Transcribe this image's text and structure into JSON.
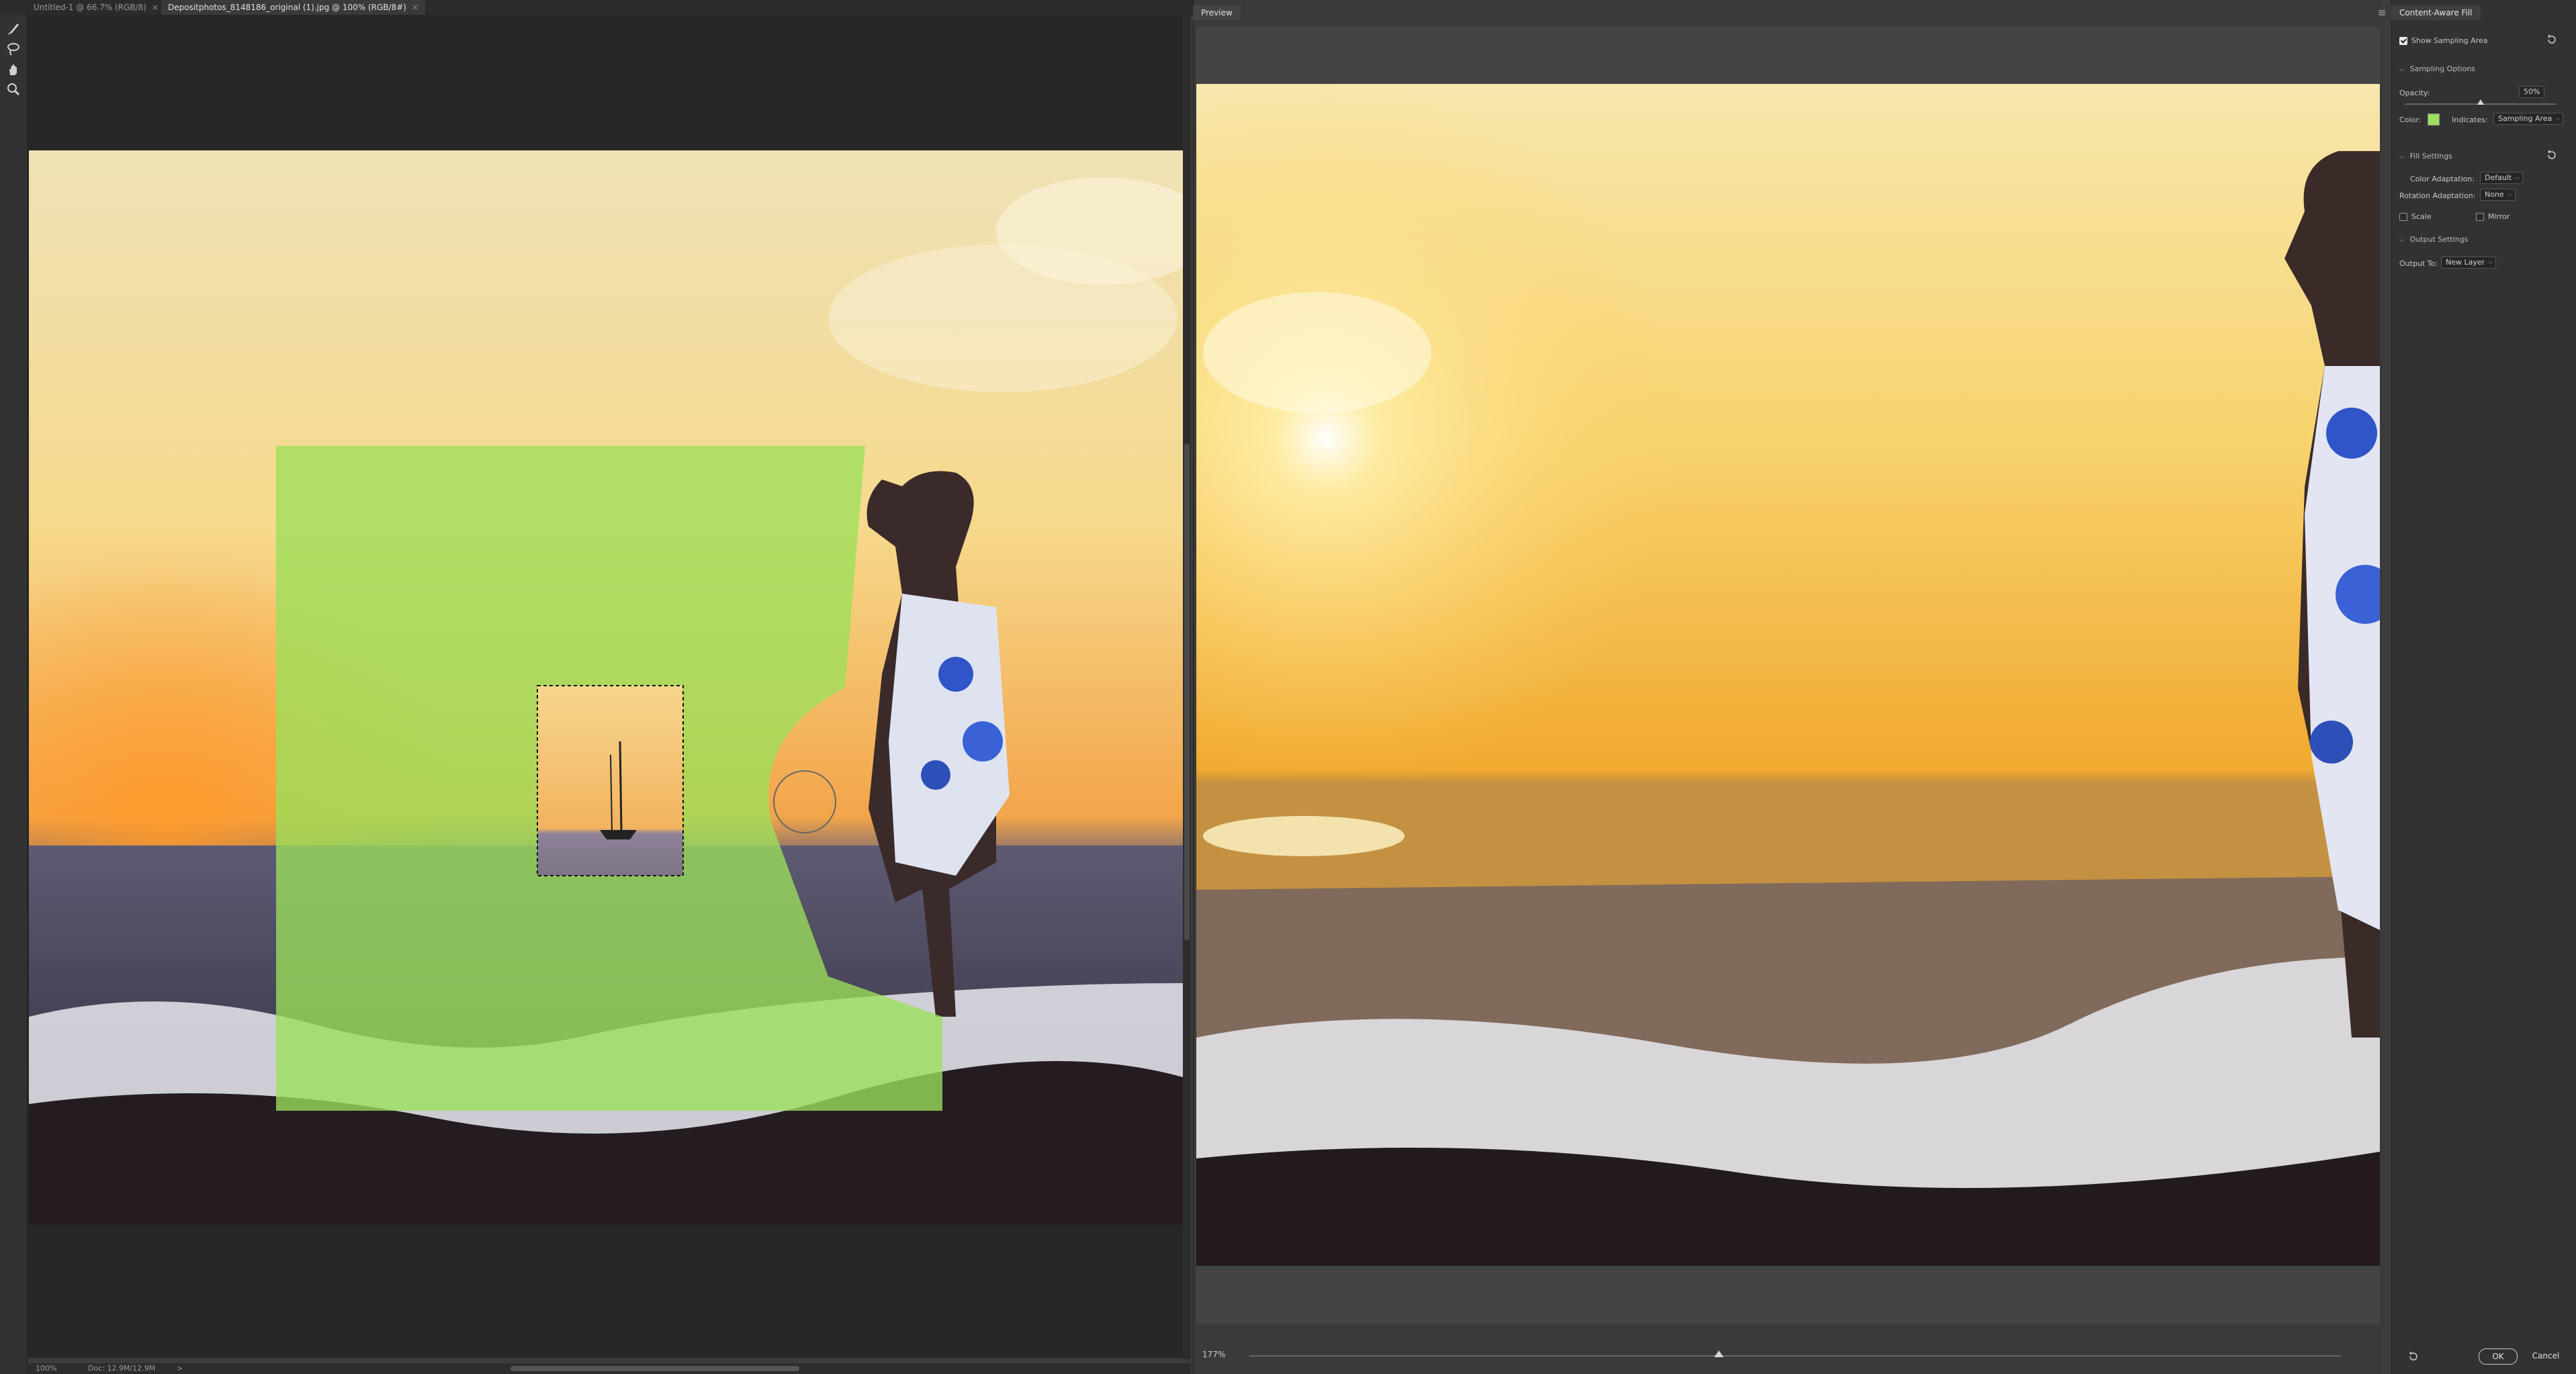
{
  "tabs": [
    {
      "label": "Untitled-1 @ 66.7% (RGB/8)",
      "close": "×"
    },
    {
      "label": "Depositphotos_8148186_original (1).jpg @ 100% (RGB/8#)",
      "close": "×"
    }
  ],
  "tools": [
    "sampling-brush-icon",
    "lasso-icon",
    "hand-icon",
    "zoom-icon"
  ],
  "status": {
    "zoom": "100%",
    "doc": "Doc: 12.9M/12.9M",
    "arrow": ">"
  },
  "preview": {
    "tab": "Preview",
    "zoom": "177%",
    "zoom_slider": 0.43
  },
  "panel": {
    "title": "Content-Aware Fill",
    "show_sampling_area": "Show Sampling Area",
    "sampling_options": "Sampling Options",
    "opacity_label": "Opacity:",
    "opacity_value": "50%",
    "opacity": 0.5,
    "color_label": "Color:",
    "indicates_label": "Indicates:",
    "indicates_value": "Sampling Area",
    "fill_settings": "Fill Settings",
    "color_adaptation_label": "Color Adaptation:",
    "color_adaptation_value": "Default",
    "rotation_adaptation_label": "Rotation Adaptation:",
    "rotation_adaptation_value": "None",
    "scale_label": "Scale",
    "mirror_label": "Mirror",
    "output_settings": "Output Settings",
    "output_to_label": "Output To:",
    "output_to_value": "New Layer",
    "ok": "OK",
    "cancel": "Cancel"
  },
  "colors": {
    "sampling_overlay": "#9be05a",
    "accent": "#d8d8d8"
  }
}
